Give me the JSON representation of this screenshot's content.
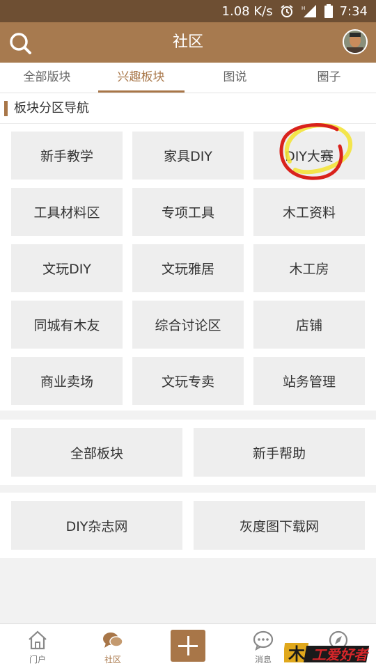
{
  "status_bar": {
    "speed": "1.08 K/s",
    "time": "7:34"
  },
  "app_bar": {
    "title": "社区"
  },
  "tabs": [
    {
      "label": "全部版块",
      "active": false
    },
    {
      "label": "兴趣板块",
      "active": true
    },
    {
      "label": "图说",
      "active": false
    },
    {
      "label": "圈子",
      "active": false
    }
  ],
  "section": {
    "title": "板块分区导航"
  },
  "boards": [
    "新手教学",
    "家具DIY",
    "DIY大赛",
    "工具材料区",
    "专项工具",
    "木工资料",
    "文玩DIY",
    "文玩雅居",
    "木工房",
    "同城有木友",
    "综合讨论区",
    "店铺",
    "商业卖场",
    "文玩专卖",
    "站务管理"
  ],
  "links_row1": [
    "全部板块",
    "新手帮助"
  ],
  "links_row2": [
    "DIY杂志网",
    "灰度图下载网"
  ],
  "bottom_nav": {
    "items": [
      {
        "label": "门户"
      },
      {
        "label": "社区",
        "active": true
      },
      {
        "label": ""
      },
      {
        "label": "消息"
      },
      {
        "label": ""
      }
    ]
  },
  "watermark": {
    "text": "木工爱好者"
  },
  "colors": {
    "accent": "#a87648",
    "header": "#a77a4f",
    "status_bar": "#6e4f33",
    "annotation_circle": "#d9221c",
    "annotation_highlight": "#f3e33a"
  }
}
